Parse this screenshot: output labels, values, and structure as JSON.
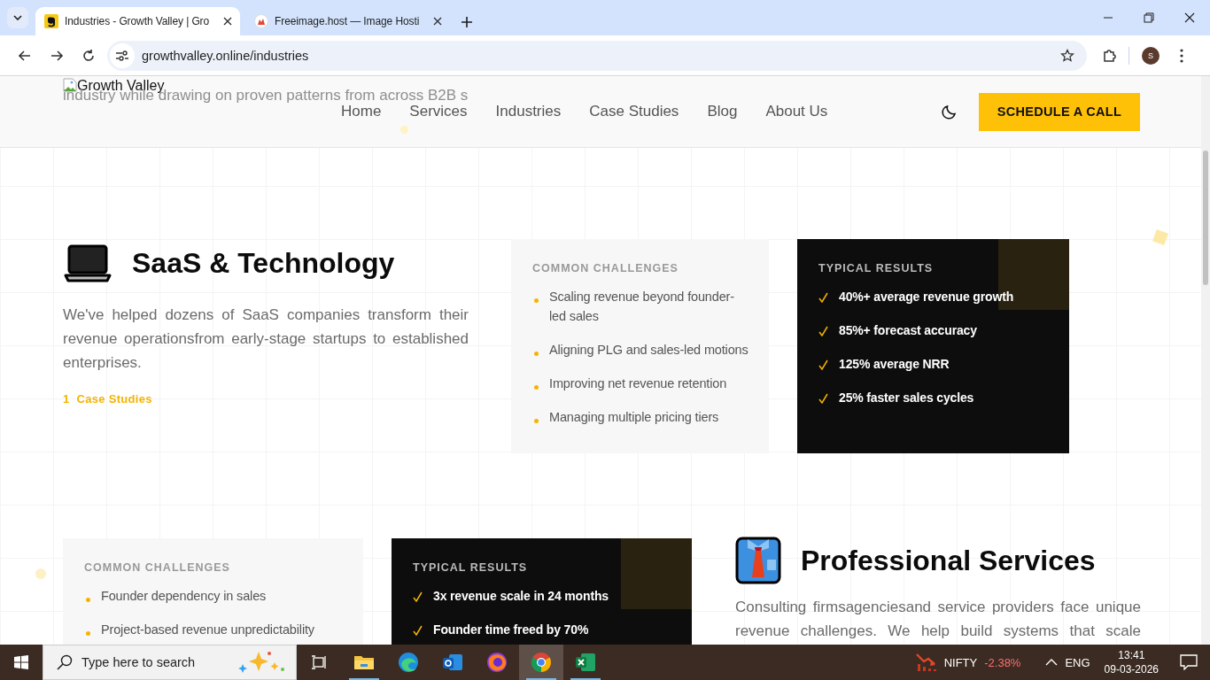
{
  "browser": {
    "tabs": [
      {
        "title": "Industries - Growth Valley | Gro",
        "selected": true
      },
      {
        "title": "Freeimage.host — Image Hosti",
        "selected": false
      }
    ],
    "address": "growthvalley.online/industries",
    "profile_initial": "S"
  },
  "header": {
    "logo_alt": "Growth Valley",
    "background_text": "industry while drawing on proven patterns from across B2B s",
    "nav": [
      {
        "label": "Home"
      },
      {
        "label": "Services"
      },
      {
        "label": "Industries"
      },
      {
        "label": "Case Studies"
      },
      {
        "label": "Blog"
      },
      {
        "label": "About Us"
      }
    ],
    "cta": "SCHEDULE A CALL"
  },
  "industries": [
    {
      "kind": "text-left",
      "title": "SaaS & Technology",
      "description": "We've helped dozens of SaaS companies transform their revenue operationsfrom early-stage startups to established enterprises.",
      "case_count": "1",
      "case_label": "Case Studies",
      "challenges_title": "COMMON CHALLENGES",
      "challenges": [
        "Scaling revenue beyond founder-led sales",
        "Aligning PLG and sales-led motions",
        "Improving net revenue retention",
        "Managing multiple pricing tiers"
      ],
      "results_title": "TYPICAL RESULTS",
      "results": [
        "40%+ average revenue growth",
        "85%+ forecast accuracy",
        "125% average NRR",
        "25% faster sales cycles"
      ]
    },
    {
      "kind": "text-right",
      "title": "Professional Services",
      "description": "Consulting firmsagenciesand service providers face unique revenue challenges. We help build systems that scale",
      "challenges_title": "COMMON CHALLENGES",
      "challenges": [
        "Founder dependency in sales",
        "Project-based revenue unpredictability"
      ],
      "results_title": "TYPICAL RESULTS",
      "results": [
        "3x revenue scale in 24 months",
        "Founder time freed by 70%"
      ]
    }
  ],
  "taskbar": {
    "search_placeholder": "Type here to search",
    "apps": [
      {
        "running": false,
        "selected": false
      },
      {
        "running": true,
        "selected": false
      },
      {
        "running": false,
        "selected": false
      },
      {
        "running": false,
        "selected": false
      },
      {
        "running": false,
        "selected": false
      },
      {
        "running": true,
        "selected": true
      },
      {
        "running": true,
        "selected": false
      }
    ],
    "ticker": {
      "name": "NIFTY",
      "change": "-2.38%"
    },
    "language": "ENG",
    "time": "13:41",
    "date": "09-03-2026"
  }
}
